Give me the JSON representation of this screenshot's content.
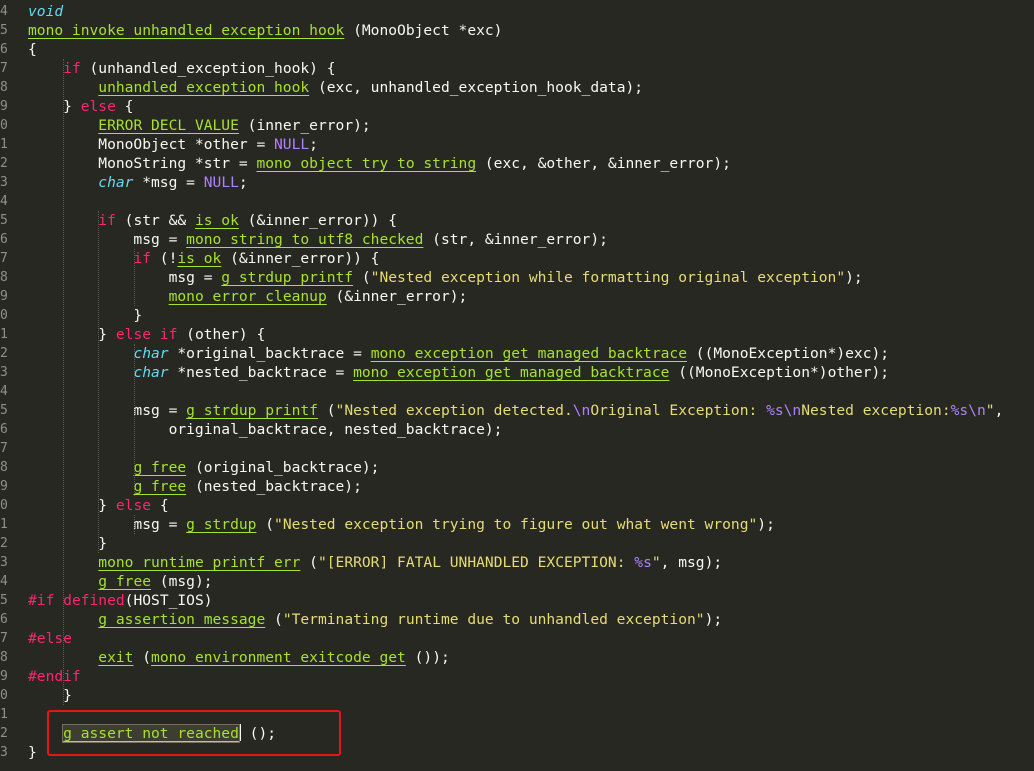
{
  "editor": {
    "language": "C",
    "theme_colors": {
      "background": "#272822",
      "text": "#f8f8f2",
      "keyword": "#f92672",
      "function": "#a6e22e",
      "type": "#66d9ef",
      "string": "#e6db74",
      "constant": "#ae81ff",
      "annotation_box": "#e6141b"
    },
    "lines": [
      {
        "no": "4",
        "tokens": [
          {
            "c": "type",
            "t": "void"
          }
        ]
      },
      {
        "no": "5",
        "tokens": [
          {
            "c": "func",
            "t": "mono_invoke_unhandled_exception_hook"
          },
          {
            "c": "plain",
            "t": " (MonoObject *exc)"
          }
        ]
      },
      {
        "no": "6",
        "tokens": [
          {
            "c": "plain",
            "t": "{"
          }
        ]
      },
      {
        "no": "7",
        "tokens": [
          {
            "c": "plain",
            "t": "    "
          },
          {
            "c": "kw",
            "t": "if"
          },
          {
            "c": "plain",
            "t": " (unhandled_exception_hook) {"
          }
        ]
      },
      {
        "no": "8",
        "tokens": [
          {
            "c": "plain",
            "t": "        "
          },
          {
            "c": "func",
            "t": "unhandled_exception_hook"
          },
          {
            "c": "plain",
            "t": " (exc, unhandled_exception_hook_data);"
          }
        ]
      },
      {
        "no": "9",
        "tokens": [
          {
            "c": "plain",
            "t": "    } "
          },
          {
            "c": "kw",
            "t": "else"
          },
          {
            "c": "plain",
            "t": " {"
          }
        ]
      },
      {
        "no": "0",
        "tokens": [
          {
            "c": "plain",
            "t": "        "
          },
          {
            "c": "func",
            "t": "ERROR_DECL_VALUE"
          },
          {
            "c": "plain",
            "t": " (inner_error);"
          }
        ]
      },
      {
        "no": "1",
        "tokens": [
          {
            "c": "plain",
            "t": "        MonoObject *other = "
          },
          {
            "c": "const",
            "t": "NULL"
          },
          {
            "c": "plain",
            "t": ";"
          }
        ]
      },
      {
        "no": "2",
        "tokens": [
          {
            "c": "plain",
            "t": "        MonoString *str = "
          },
          {
            "c": "func",
            "t": "mono_object_try_to_string"
          },
          {
            "c": "plain",
            "t": " (exc, &other, &inner_error);"
          }
        ]
      },
      {
        "no": "3",
        "tokens": [
          {
            "c": "plain",
            "t": "        "
          },
          {
            "c": "type",
            "t": "char"
          },
          {
            "c": "plain",
            "t": " *msg = "
          },
          {
            "c": "const",
            "t": "NULL"
          },
          {
            "c": "plain",
            "t": ";"
          }
        ]
      },
      {
        "no": "4",
        "tokens": []
      },
      {
        "no": "5",
        "tokens": [
          {
            "c": "plain",
            "t": "        "
          },
          {
            "c": "kw",
            "t": "if"
          },
          {
            "c": "plain",
            "t": " (str && "
          },
          {
            "c": "func",
            "t": "is_ok"
          },
          {
            "c": "plain",
            "t": " (&inner_error)) {"
          }
        ]
      },
      {
        "no": "6",
        "tokens": [
          {
            "c": "plain",
            "t": "            msg = "
          },
          {
            "c": "func",
            "t": "mono_string_to_utf8_checked"
          },
          {
            "c": "plain",
            "t": " (str, &inner_error);"
          }
        ]
      },
      {
        "no": "7",
        "tokens": [
          {
            "c": "plain",
            "t": "            "
          },
          {
            "c": "kw",
            "t": "if"
          },
          {
            "c": "plain",
            "t": " (!"
          },
          {
            "c": "func",
            "t": "is_ok"
          },
          {
            "c": "plain",
            "t": " (&inner_error)) {"
          }
        ]
      },
      {
        "no": "8",
        "tokens": [
          {
            "c": "plain",
            "t": "                msg = "
          },
          {
            "c": "func",
            "t": "g_strdup_printf"
          },
          {
            "c": "plain",
            "t": " ("
          },
          {
            "c": "str",
            "t": "\"Nested exception while formatting original exception\""
          },
          {
            "c": "plain",
            "t": ");"
          }
        ]
      },
      {
        "no": "9",
        "tokens": [
          {
            "c": "plain",
            "t": "                "
          },
          {
            "c": "func",
            "t": "mono_error_cleanup"
          },
          {
            "c": "plain",
            "t": " (&inner_error);"
          }
        ]
      },
      {
        "no": "0",
        "tokens": [
          {
            "c": "plain",
            "t": "            }"
          }
        ]
      },
      {
        "no": "1",
        "tokens": [
          {
            "c": "plain",
            "t": "        } "
          },
          {
            "c": "kw",
            "t": "else if"
          },
          {
            "c": "plain",
            "t": " (other) {"
          }
        ]
      },
      {
        "no": "2",
        "tokens": [
          {
            "c": "plain",
            "t": "            "
          },
          {
            "c": "type",
            "t": "char"
          },
          {
            "c": "plain",
            "t": " *original_backtrace = "
          },
          {
            "c": "func",
            "t": "mono_exception_get_managed_backtrace"
          },
          {
            "c": "plain",
            "t": " ((MonoException*)exc);"
          }
        ]
      },
      {
        "no": "3",
        "tokens": [
          {
            "c": "plain",
            "t": "            "
          },
          {
            "c": "type",
            "t": "char"
          },
          {
            "c": "plain",
            "t": " *nested_backtrace = "
          },
          {
            "c": "func",
            "t": "mono_exception_get_managed_backtrace"
          },
          {
            "c": "plain",
            "t": " ((MonoException*)other);"
          }
        ]
      },
      {
        "no": "4",
        "tokens": []
      },
      {
        "no": "5",
        "tokens": [
          {
            "c": "plain",
            "t": "            msg = "
          },
          {
            "c": "func",
            "t": "g_strdup_printf"
          },
          {
            "c": "plain",
            "t": " ("
          },
          {
            "c": "str",
            "t": "\"Nested exception detected."
          },
          {
            "c": "esc",
            "t": "\\n"
          },
          {
            "c": "str",
            "t": "Original Exception: "
          },
          {
            "c": "esc",
            "t": "%s\\n"
          },
          {
            "c": "str",
            "t": "Nested exception:"
          },
          {
            "c": "esc",
            "t": "%s\\n"
          },
          {
            "c": "str",
            "t": "\""
          },
          {
            "c": "plain",
            "t": ","
          }
        ]
      },
      {
        "no": "6",
        "tokens": [
          {
            "c": "plain",
            "t": "                original_backtrace, nested_backtrace);"
          }
        ]
      },
      {
        "no": "7",
        "tokens": []
      },
      {
        "no": "8",
        "tokens": [
          {
            "c": "plain",
            "t": "            "
          },
          {
            "c": "func",
            "t": "g_free"
          },
          {
            "c": "plain",
            "t": " (original_backtrace);"
          }
        ]
      },
      {
        "no": "9",
        "tokens": [
          {
            "c": "plain",
            "t": "            "
          },
          {
            "c": "func",
            "t": "g_free"
          },
          {
            "c": "plain",
            "t": " (nested_backtrace);"
          }
        ]
      },
      {
        "no": "0",
        "tokens": [
          {
            "c": "plain",
            "t": "        } "
          },
          {
            "c": "kw",
            "t": "else"
          },
          {
            "c": "plain",
            "t": " {"
          }
        ]
      },
      {
        "no": "1",
        "tokens": [
          {
            "c": "plain",
            "t": "            msg = "
          },
          {
            "c": "func",
            "t": "g_strdup"
          },
          {
            "c": "plain",
            "t": " ("
          },
          {
            "c": "str",
            "t": "\"Nested exception trying to figure out what went wrong\""
          },
          {
            "c": "plain",
            "t": ");"
          }
        ]
      },
      {
        "no": "2",
        "tokens": [
          {
            "c": "plain",
            "t": "        }"
          }
        ]
      },
      {
        "no": "3",
        "tokens": [
          {
            "c": "plain",
            "t": "        "
          },
          {
            "c": "func",
            "t": "mono_runtime_printf_err"
          },
          {
            "c": "plain",
            "t": " ("
          },
          {
            "c": "str",
            "t": "\"[ERROR] FATAL UNHANDLED EXCEPTION: "
          },
          {
            "c": "esc",
            "t": "%s"
          },
          {
            "c": "str",
            "t": "\""
          },
          {
            "c": "plain",
            "t": ", msg);"
          }
        ]
      },
      {
        "no": "4",
        "tokens": [
          {
            "c": "plain",
            "t": "        "
          },
          {
            "c": "func",
            "t": "g_free"
          },
          {
            "c": "plain",
            "t": " (msg);"
          }
        ]
      },
      {
        "no": "5",
        "tokens": [
          {
            "c": "pre",
            "t": "#if"
          },
          {
            "c": "plain",
            "t": " "
          },
          {
            "c": "kw",
            "t": "defined"
          },
          {
            "c": "plain",
            "t": "(HOST_IOS)"
          }
        ]
      },
      {
        "no": "6",
        "tokens": [
          {
            "c": "plain",
            "t": "        "
          },
          {
            "c": "func",
            "t": "g_assertion_message"
          },
          {
            "c": "plain",
            "t": " ("
          },
          {
            "c": "str",
            "t": "\"Terminating runtime due to unhandled exception\""
          },
          {
            "c": "plain",
            "t": ");"
          }
        ]
      },
      {
        "no": "7",
        "tokens": [
          {
            "c": "pre",
            "t": "#else"
          }
        ]
      },
      {
        "no": "8",
        "tokens": [
          {
            "c": "plain",
            "t": "        "
          },
          {
            "c": "func",
            "t": "exit"
          },
          {
            "c": "plain",
            "t": " ("
          },
          {
            "c": "func",
            "t": "mono_environment_exitcode_get"
          },
          {
            "c": "plain",
            "t": " ());"
          }
        ]
      },
      {
        "no": "9",
        "tokens": [
          {
            "c": "pre",
            "t": "#endif"
          }
        ]
      },
      {
        "no": "0",
        "tokens": [
          {
            "c": "plain",
            "t": "    }"
          }
        ]
      },
      {
        "no": "1",
        "tokens": []
      },
      {
        "no": "2",
        "tokens": [
          {
            "c": "plain",
            "t": "    "
          },
          {
            "c": "selword",
            "t": "g_assert_not_reached"
          },
          {
            "c": "cursor",
            "t": ""
          },
          {
            "c": "plain",
            "t": " ();"
          }
        ]
      },
      {
        "no": "3",
        "tokens": [
          {
            "c": "plain",
            "t": "}"
          }
        ]
      }
    ]
  }
}
